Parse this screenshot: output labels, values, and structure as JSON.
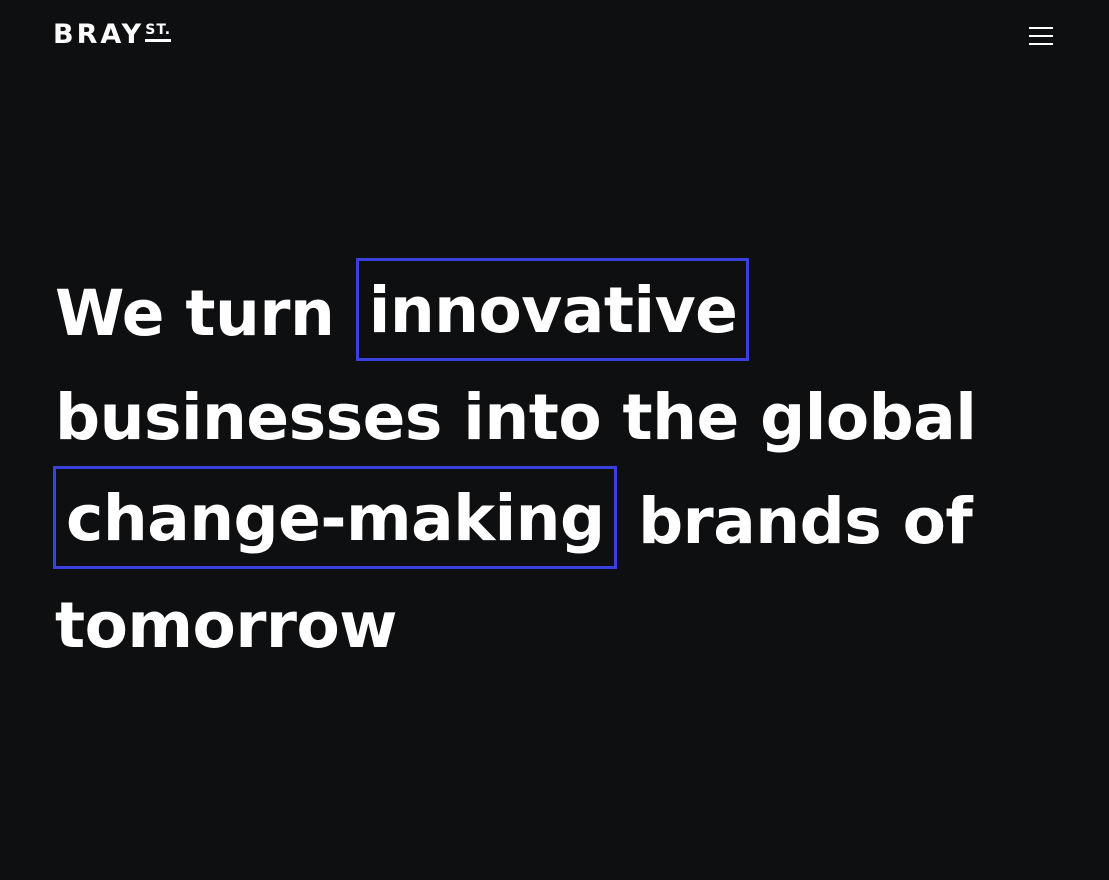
{
  "header": {
    "logo_main": "BRAY",
    "logo_sup": "ST.",
    "menu_icon": "hamburger-menu-icon"
  },
  "hero": {
    "line1_text": "We turn ",
    "line1_highlight": "innovative",
    "line2_text": "businesses into the global",
    "line3_highlight": "change-making",
    "line3_text": " brands of",
    "line4_text": "tomorrow"
  },
  "colors": {
    "background": "#0e0f11",
    "text": "#ffffff",
    "highlight_border": "#3a3fe0"
  }
}
